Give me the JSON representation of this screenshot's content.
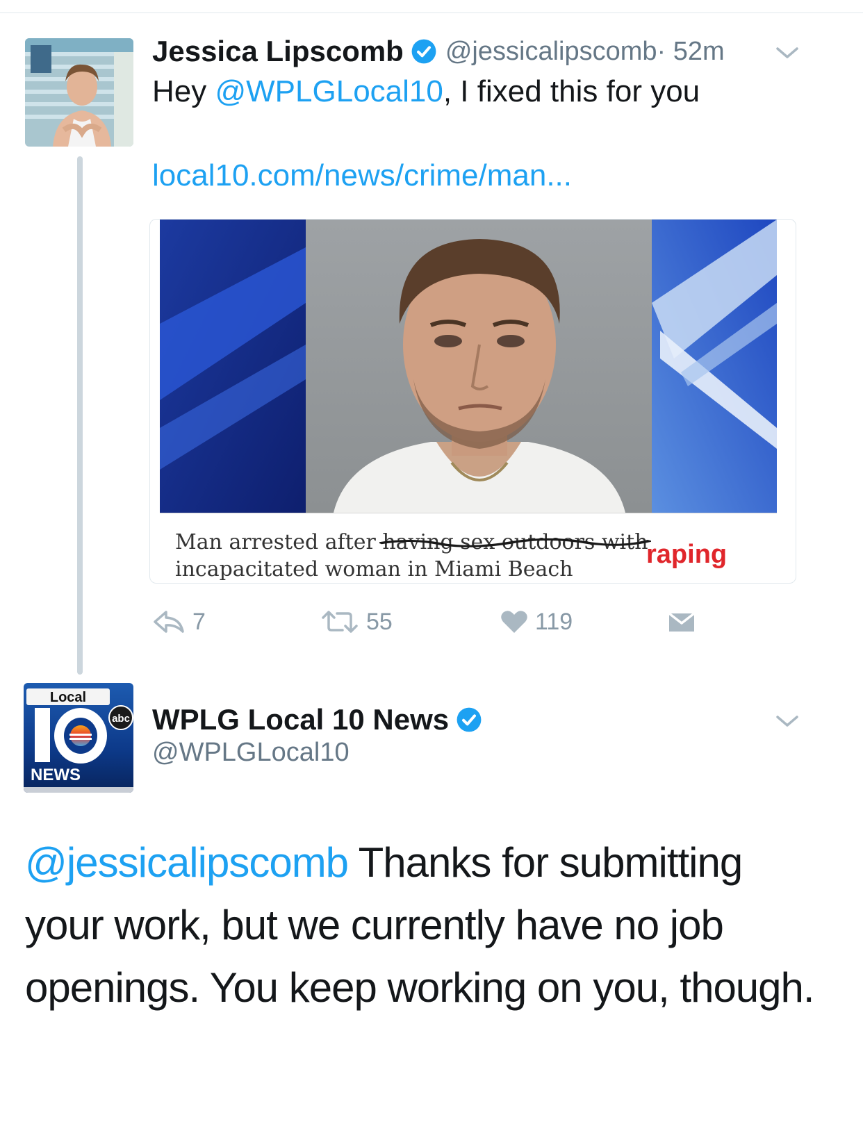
{
  "tweet1": {
    "display_name": "Jessica Lipscomb",
    "handle": "@jessicalipscomb",
    "time": "· 52m",
    "text_prefix": "Hey ",
    "text_mention": "@WPLGLocal10",
    "text_suffix": ", I fixed this for you",
    "link": "local10.com/news/crime/man...",
    "card": {
      "caption_start": "Man arrested after ",
      "caption_struck": "having sex outdoors with",
      "caption_insert": "raping",
      "caption_line2": "incapacitated woman in Miami Beach"
    },
    "actions": {
      "reply_count": "7",
      "retweet_count": "55",
      "like_count": "119"
    }
  },
  "tweet2": {
    "display_name": "WPLG Local 10 News",
    "handle": "@WPLGLocal10",
    "logo_top": "Local",
    "logo_bottom": "NEWS",
    "logo_abc": "abc",
    "text_mention": "@jessicalipscomb",
    "text_body": " Thanks for submitting your work, but we currently have no job openings. You keep working on you, though."
  },
  "colors": {
    "link_blue": "#1da1f2",
    "secondary_gray": "#657786",
    "action_gray": "#8899a6",
    "raping_red": "#e0262b"
  }
}
